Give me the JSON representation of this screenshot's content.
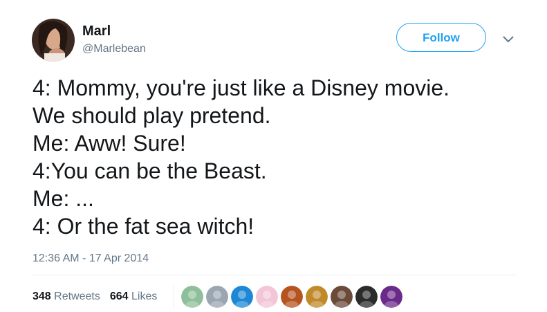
{
  "user": {
    "display_name": "Marl",
    "handle": "@Marlebean"
  },
  "follow_label": "Follow",
  "tweet": {
    "text": "4: Mommy, you're just like a Disney movie.\nWe should play pretend.\nMe: Aww! Sure!\n4:You can be the Beast.\nMe: ...\n4: Or the fat sea witch!",
    "timestamp": "12:36 AM - 17 Apr 2014"
  },
  "stats": {
    "retweets_count": "348",
    "retweets_label": "Retweets",
    "likes_count": "664",
    "likes_label": "Likes"
  },
  "liker_avatars": [
    {
      "name": "liker-avatar-1",
      "color": "#8fbf9a"
    },
    {
      "name": "liker-avatar-2",
      "color": "#9aa6b2"
    },
    {
      "name": "liker-avatar-3",
      "color": "#1e88d6"
    },
    {
      "name": "liker-avatar-4",
      "color": "#f2c6d6"
    },
    {
      "name": "liker-avatar-5",
      "color": "#b5541f"
    },
    {
      "name": "liker-avatar-6",
      "color": "#c08a2a"
    },
    {
      "name": "liker-avatar-7",
      "color": "#6b4a3a"
    },
    {
      "name": "liker-avatar-8",
      "color": "#2b2b2b"
    },
    {
      "name": "liker-avatar-9",
      "color": "#6a2a8a"
    }
  ],
  "colors": {
    "accent": "#1da1f2",
    "text": "#14171a",
    "secondary": "#657786"
  }
}
